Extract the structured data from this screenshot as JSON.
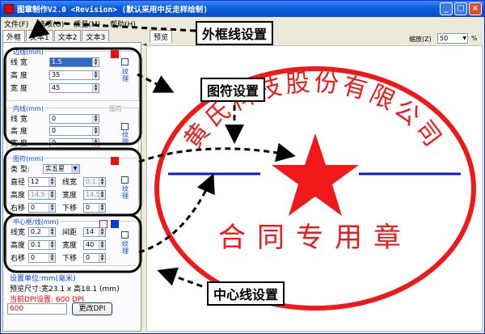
{
  "window": {
    "title": "图章制作V2.0 <Revision> (默认采用中反走样绘制)",
    "buttons": {
      "minimize": "_",
      "maximize": "□",
      "close": "×"
    }
  },
  "menu": [
    "文件(F)",
    "选项(O)",
    "质量(M)",
    "帮助(H)"
  ],
  "tabs": [
    "外框",
    "文本1",
    "文本2",
    "文本3"
  ],
  "preview_tab": "预览",
  "zoom": {
    "label": "缩放(Z)",
    "value": "50",
    "unit": "%"
  },
  "outer_line": {
    "label": "边线(mm)",
    "color": "#e81010",
    "fields": [
      {
        "label": "线 宽",
        "value": "1.5"
      },
      {
        "label": "高 度",
        "value": "35"
      },
      {
        "label": "宽 度",
        "value": "45"
      }
    ],
    "texture_label": "纹理"
  },
  "inner_line": {
    "label": "内线(mm)",
    "color_label": "图符",
    "fields": [
      {
        "label": "线 宽",
        "value": "0"
      },
      {
        "label": "高 度",
        "value": "0"
      },
      {
        "label": "宽 度",
        "value": "0"
      }
    ],
    "texture_label": "纹理"
  },
  "symbol": {
    "label": "图符(mm)",
    "color": "#e81010",
    "type_label": "类 型:",
    "type_value": "实五星",
    "diameter_label": "直径",
    "diameter_value": "12",
    "linewidth_label": "线宽",
    "linewidth_value": "0.1",
    "height_label": "高度",
    "height_value": "14.5",
    "width_label": "宽度",
    "width_value": "14.5",
    "right_label": "右移",
    "right_value": "0",
    "down_label": "下移",
    "down_value": "0",
    "texture_label": "纹理"
  },
  "centerline": {
    "label": "中心框/线(mm)",
    "color": "#0a3ad8",
    "linewidth_label": "线宽",
    "linewidth_value": "0.2",
    "gap_label": "间距",
    "gap_value": "14",
    "height_label": "高度",
    "height_value": "0.1",
    "width_label": "宽度",
    "width_value": "40",
    "right_label": "右移",
    "right_value": "0",
    "down_label": "下移",
    "down_value": "0",
    "texture_label": "纹理"
  },
  "info": {
    "unit": "设置单位:mm(毫米)",
    "size": "预览尺寸:宽23.1 x 高18.1 (mm)",
    "dpi": "当前DPI设置: 600 DPI",
    "dpi_input": "600",
    "dpi_button": "更改DPI"
  },
  "stamp": {
    "company_text": "黄氏科技股份有限公司",
    "bottom_text": "合同专用章",
    "red": "#f01818",
    "blue": "#0a1ad0"
  },
  "callouts": {
    "outer": "外框线设置",
    "symbol": "图符设置",
    "centerline": "中心线设置"
  }
}
